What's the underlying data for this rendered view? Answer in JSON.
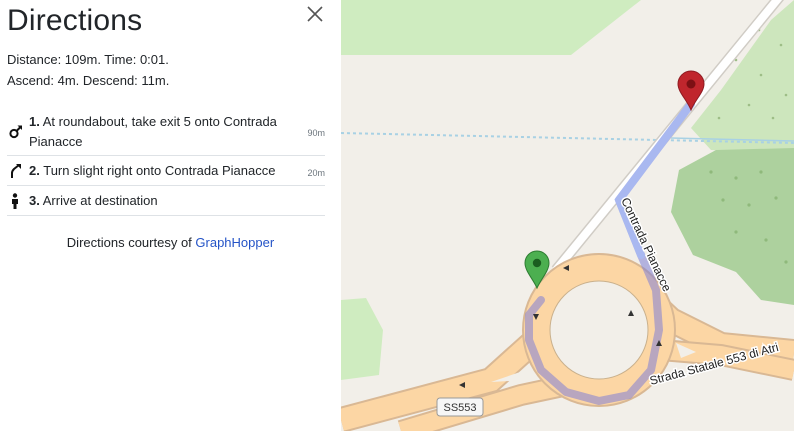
{
  "panel": {
    "title": "Directions",
    "close_icon": "close-icon",
    "summary_line1": "Distance: 109m. Time: 0:01.",
    "summary_line2": "Ascend: 4m. Descend: 11m.",
    "steps": [
      {
        "icon": "roundabout-icon",
        "number": "1.",
        "text": "At roundabout, take exit 5 onto Contrada Pianacce",
        "distance": "90m"
      },
      {
        "icon": "turn-slight-right-icon",
        "number": "2.",
        "text": "Turn slight right onto Contrada Pianacce",
        "distance": "20m"
      },
      {
        "icon": "arrive-icon",
        "number": "3.",
        "text": "Arrive at destination",
        "distance": ""
      }
    ],
    "courtesy_prefix": "Directions courtesy of ",
    "courtesy_link": "GraphHopper",
    "link_color": "#2554c7"
  },
  "map": {
    "road_labels": [
      "Contrada Pianacce",
      "Strada Statale 553 di Atri"
    ],
    "shield_label": "SS553",
    "start_marker_color": "#4caf50",
    "end_marker_color": "#c0262d",
    "route_color": "#a9b8f0"
  }
}
